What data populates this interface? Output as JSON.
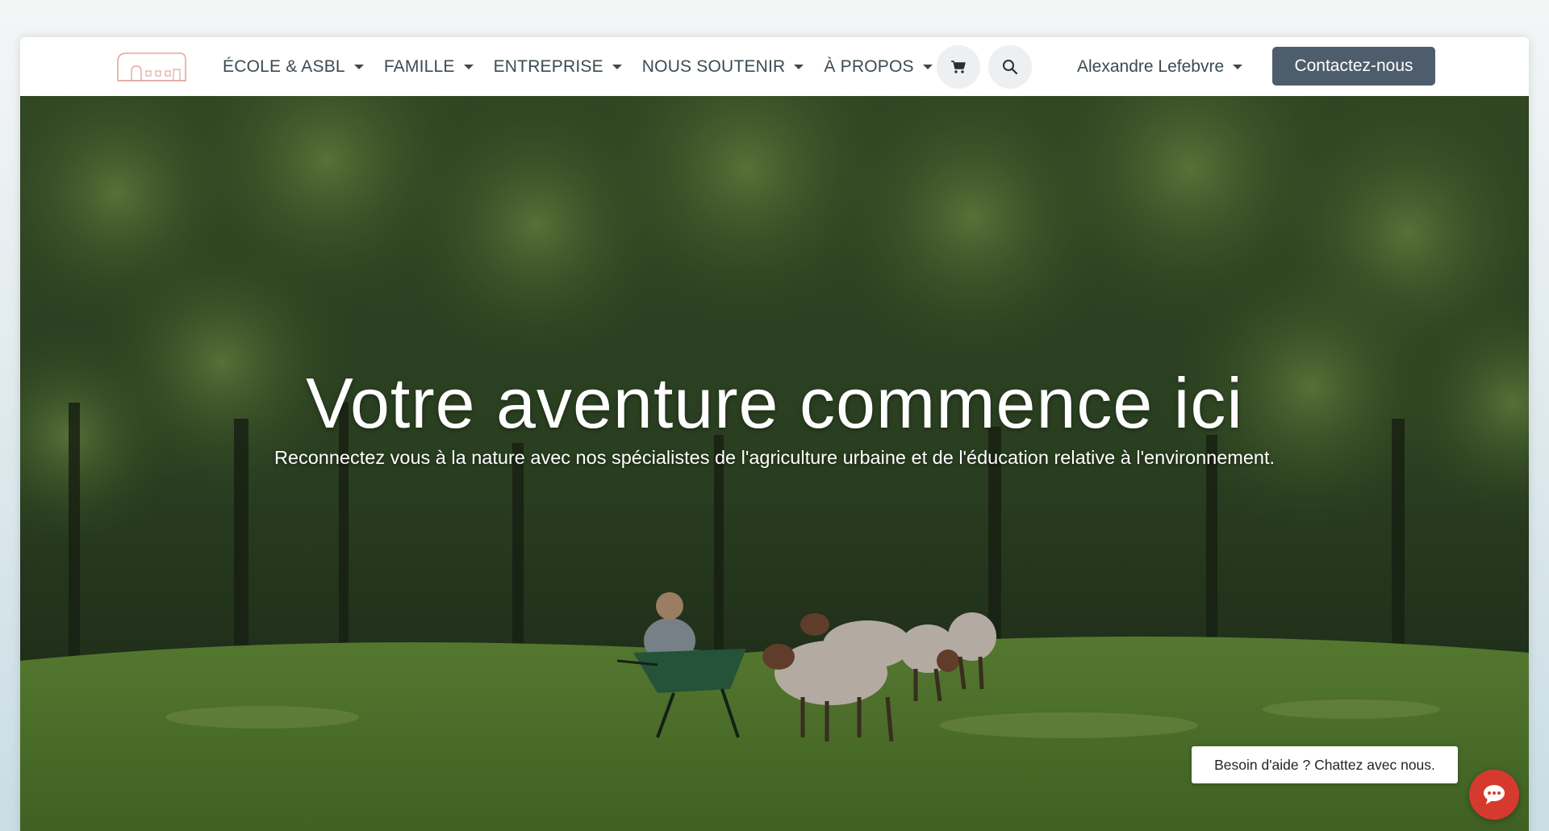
{
  "navbar": {
    "logo_icon": "house-logo-icon",
    "items": [
      {
        "label": "ÉCOLE & ASBL"
      },
      {
        "label": "FAMILLE"
      },
      {
        "label": "ENTREPRISE"
      },
      {
        "label": "NOUS SOUTENIR"
      },
      {
        "label": "À PROPOS"
      }
    ],
    "cart_icon": "shopping-cart-icon",
    "search_icon": "search-icon",
    "user_name": "Alexandre Lefebvre",
    "contact_label": "Contactez-nous"
  },
  "hero": {
    "title": "Votre aventure commence ici",
    "subtitle": "Reconnectez vous à la nature avec nos spécialistes de l'agriculture urbaine et de l'éducation relative à l'environnement."
  },
  "chat": {
    "bubble_text": "Besoin d'aide ? Chattez avec nous.",
    "icon": "chat-icon"
  },
  "colors": {
    "nav_text": "#3c4a52",
    "contact_button_bg": "#4e5d6b",
    "chat_button_bg": "#d63a2f"
  }
}
